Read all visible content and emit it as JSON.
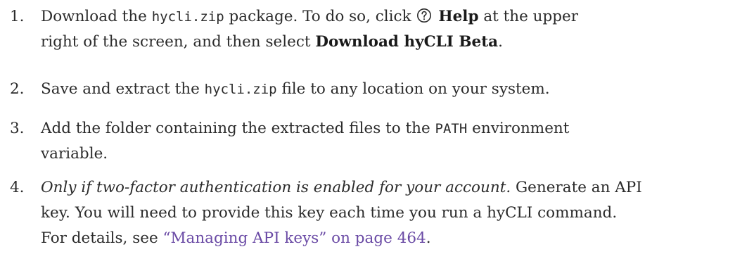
{
  "steps": [
    {
      "number": "1.",
      "line1_a": "Download the ",
      "line1_code": "hycli.zip",
      "line1_b": " package. To do so, click ",
      "help_label": "Help",
      "line1_c": " at the upper",
      "line2_a": "right of the screen, and then select ",
      "download_label": "Download hyCLI Beta",
      "line2_b": "."
    },
    {
      "number": "2.",
      "text_a": "Save and extract the ",
      "code": "hycli.zip",
      "text_b": " file to any location on your system."
    },
    {
      "number": "3.",
      "line1_a": "Add the folder containing the extracted files to the ",
      "code": "PATH",
      "line1_b": " environment",
      "line2": "variable."
    },
    {
      "number": "4.",
      "line1_em": "Only if two-factor authentication is enabled for your account.",
      "line1_b": " Generate an API",
      "line2": "key. You will need to provide this key each time you run a hyCLI command.",
      "line3_a": "For details, see ",
      "link_text": "“Managing API keys” on page 464",
      "line3_b": "."
    }
  ],
  "icons": {
    "help": "help-circle-icon"
  },
  "colors": {
    "text": "#2b2b2b",
    "link": "#6a4aa5"
  }
}
